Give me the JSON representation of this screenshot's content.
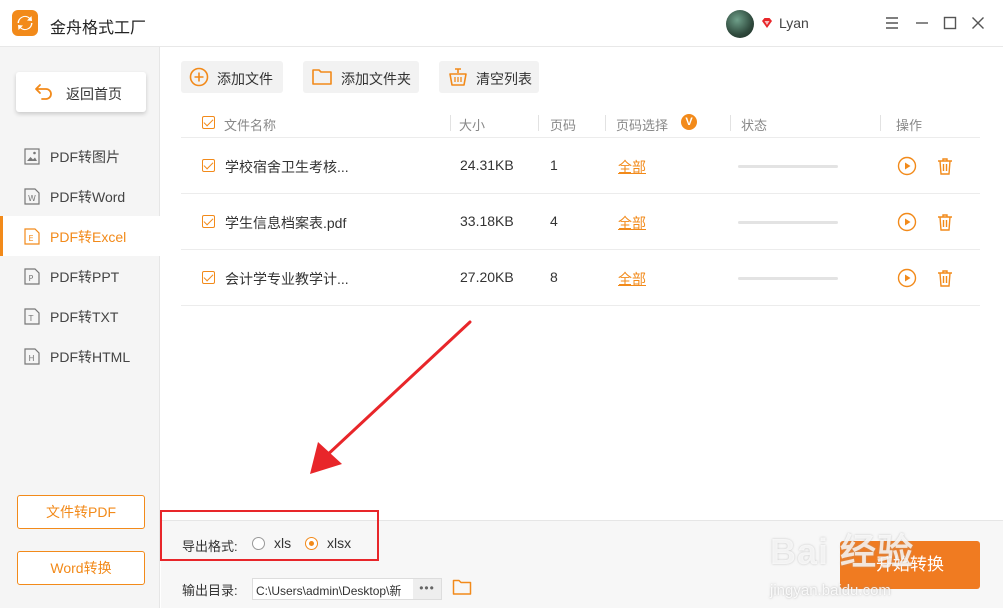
{
  "app": {
    "title": "金舟格式工厂",
    "username": "Lyan"
  },
  "colors": {
    "accent": "#f28a1a",
    "annotation": "#e8262a",
    "start_button": "#f07b21"
  },
  "sidebar": {
    "home_label": "返回首页",
    "items": [
      {
        "label": "PDF转图片",
        "icon": "image-file-icon",
        "active": false
      },
      {
        "label": "PDF转Word",
        "icon": "word-file-icon",
        "active": false
      },
      {
        "label": "PDF转Excel",
        "icon": "excel-file-icon",
        "active": true
      },
      {
        "label": "PDF转PPT",
        "icon": "ppt-file-icon",
        "active": false
      },
      {
        "label": "PDF转TXT",
        "icon": "txt-file-icon",
        "active": false
      },
      {
        "label": "PDF转HTML",
        "icon": "html-file-icon",
        "active": false
      }
    ],
    "bottom_buttons": [
      "文件转PDF",
      "Word转换"
    ]
  },
  "toolbar": {
    "add_file": "添加文件",
    "add_folder": "添加文件夹",
    "clear_list": "清空列表"
  },
  "table": {
    "headers": {
      "name": "文件名称",
      "size": "大小",
      "pages": "页码",
      "page_select": "页码选择",
      "status": "状态",
      "actions": "操作"
    },
    "page_select_badge": "V",
    "rows": [
      {
        "name": "学校宿舍卫生考核...",
        "size": "24.31KB",
        "pages": "1",
        "page_select": "全部",
        "progress": 0
      },
      {
        "name": "学生信息档案表.pdf",
        "size": "33.18KB",
        "pages": "4",
        "page_select": "全部",
        "progress": 0
      },
      {
        "name": "会计学专业教学计...",
        "size": "27.20KB",
        "pages": "8",
        "page_select": "全部",
        "progress": 0
      }
    ]
  },
  "footer": {
    "format_label": "导出格式:",
    "formats": [
      {
        "label": "xls",
        "selected": false
      },
      {
        "label": "xlsx",
        "selected": true
      }
    ],
    "output_label": "输出目录:",
    "output_path": "C:\\Users\\admin\\Desktop\\新",
    "browse_label": "•••",
    "start_label": "开始转换"
  },
  "watermark": {
    "main": "Bai 经验",
    "sub": "jingyan.baidu.com"
  }
}
